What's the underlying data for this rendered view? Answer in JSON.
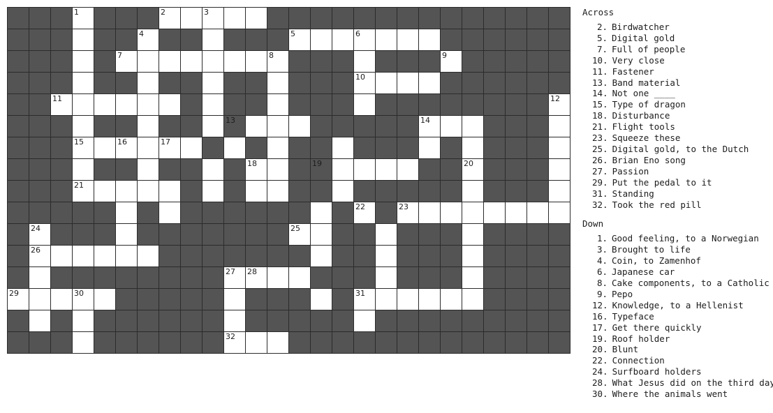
{
  "puzzle": {
    "columns": 26,
    "rows": 16,
    "cell_size_px": 31,
    "colors": {
      "block": "#545454",
      "open": "#ffffff",
      "grid_line": "#2b2b2b",
      "text": "#1c1c1c",
      "page_background": "#ffffff"
    },
    "grid": [
      "...O...OOOOO..............",
      "...O..O..O...OOOOOOO......",
      "...O.OOOOOOOO...O...O.....",
      "...O..O..O..O...OOOO......",
      "..OOOOOO.O..O...O........O",
      "...O..O..O.OOO.....OOO...O",
      "...OOOOOO.O.O..O...O.O...O",
      "...O..O..O.OO..OOOO..O...O",
      "...OOOOO.O.OO..O.....O...O",
      ".....O.O......O.O.OOOOOOOO",
      ".O...O.......OO..O...O....",
      ".OOOOOO.......O..O...O....",
      ".O........OOOO...O...O....",
      "OOOOO.....O...O.OOOOOO....",
      ".O.O......O.....O.........",
      "...O......OOO............."
    ],
    "numbers": [
      {
        "n": 1,
        "row": 0,
        "col": 3
      },
      {
        "n": 2,
        "row": 0,
        "col": 7
      },
      {
        "n": 3,
        "row": 0,
        "col": 9
      },
      {
        "n": 4,
        "row": 1,
        "col": 6
      },
      {
        "n": 5,
        "row": 1,
        "col": 13
      },
      {
        "n": 6,
        "row": 1,
        "col": 16
      },
      {
        "n": 7,
        "row": 2,
        "col": 5
      },
      {
        "n": 8,
        "row": 2,
        "col": 12
      },
      {
        "n": 9,
        "row": 2,
        "col": 20
      },
      {
        "n": 10,
        "row": 3,
        "col": 16
      },
      {
        "n": 11,
        "row": 4,
        "col": 2
      },
      {
        "n": 12,
        "row": 4,
        "col": 25
      },
      {
        "n": 13,
        "row": 5,
        "col": 10
      },
      {
        "n": 14,
        "row": 5,
        "col": 19
      },
      {
        "n": 15,
        "row": 6,
        "col": 3
      },
      {
        "n": 16,
        "row": 6,
        "col": 5
      },
      {
        "n": 17,
        "row": 6,
        "col": 7
      },
      {
        "n": 18,
        "row": 7,
        "col": 11
      },
      {
        "n": 19,
        "row": 7,
        "col": 14
      },
      {
        "n": 20,
        "row": 7,
        "col": 21
      },
      {
        "n": 21,
        "row": 8,
        "col": 3
      },
      {
        "n": 22,
        "row": 9,
        "col": 16
      },
      {
        "n": 23,
        "row": 9,
        "col": 18
      },
      {
        "n": 24,
        "row": 10,
        "col": 1
      },
      {
        "n": 25,
        "row": 10,
        "col": 13
      },
      {
        "n": 26,
        "row": 11,
        "col": 1
      },
      {
        "n": 27,
        "row": 12,
        "col": 10
      },
      {
        "n": 28,
        "row": 12,
        "col": 11
      },
      {
        "n": 29,
        "row": 13,
        "col": 0
      },
      {
        "n": 30,
        "row": 13,
        "col": 3
      },
      {
        "n": 31,
        "row": 13,
        "col": 16
      },
      {
        "n": 32,
        "row": 15,
        "col": 10
      }
    ]
  },
  "clues": {
    "across": {
      "heading": "Across",
      "items": [
        {
          "number": "2.",
          "text": "Birdwatcher"
        },
        {
          "number": "5.",
          "text": "Digital gold"
        },
        {
          "number": "7.",
          "text": "Full of people"
        },
        {
          "number": "10.",
          "text": "Very close"
        },
        {
          "number": "11.",
          "text": "Fastener"
        },
        {
          "number": "13.",
          "text": "Band material"
        },
        {
          "number": "14.",
          "text": "Not one ____"
        },
        {
          "number": "15.",
          "text": "Type of dragon"
        },
        {
          "number": "18.",
          "text": "Disturbance"
        },
        {
          "number": "21.",
          "text": "Flight tools"
        },
        {
          "number": "23.",
          "text": "Squeeze these"
        },
        {
          "number": "25.",
          "text": "Digital gold, to the Dutch"
        },
        {
          "number": "26.",
          "text": "Brian Eno song"
        },
        {
          "number": "27.",
          "text": "Passion"
        },
        {
          "number": "29.",
          "text": "Put the pedal to it"
        },
        {
          "number": "31.",
          "text": "Standing"
        },
        {
          "number": "32.",
          "text": "Took the red pill"
        }
      ]
    },
    "down": {
      "heading": "Down",
      "items": [
        {
          "number": "1.",
          "text": "Good feeling, to a Norwegian"
        },
        {
          "number": "3.",
          "text": "Brought to life"
        },
        {
          "number": "4.",
          "text": "Coin, to Zamenhof"
        },
        {
          "number": "6.",
          "text": "Japanese car"
        },
        {
          "number": "8.",
          "text": "Cake components, to a Catholic"
        },
        {
          "number": "9.",
          "text": "Pepo"
        },
        {
          "number": "12.",
          "text": "Knowledge, to a Hellenist"
        },
        {
          "number": "16.",
          "text": "Typeface"
        },
        {
          "number": "17.",
          "text": "Get there quickly"
        },
        {
          "number": "19.",
          "text": "Roof holder"
        },
        {
          "number": "20.",
          "text": "Blunt"
        },
        {
          "number": "22.",
          "text": "Connection"
        },
        {
          "number": "24.",
          "text": "Surfboard holders"
        },
        {
          "number": "28.",
          "text": "What Jesus did on the third day"
        },
        {
          "number": "30.",
          "text": "Where the animals went"
        }
      ]
    }
  }
}
